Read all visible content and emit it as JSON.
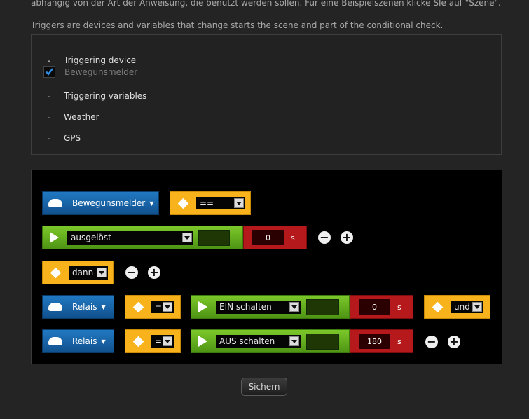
{
  "intro_text": "abhängig von der Art der Anweisung, die benutzt werden sollen. Für eine Beispielszenen klicke SIe auf \"Szene\".",
  "triggers_note": "Triggers are devices and variables that change starts the scene and part of the conditional check.",
  "triggers": {
    "device": {
      "label": "Triggering device",
      "checked_item": "Bewegunsmelder"
    },
    "variables": {
      "label": "Triggering variables"
    },
    "weather": {
      "label": "Weather"
    },
    "gps": {
      "label": "GPS"
    }
  },
  "scene": {
    "row1": {
      "device": "Bewegunsmelder",
      "operator": "=="
    },
    "row2": {
      "action": "ausgelöst",
      "delay": "0",
      "unit": "s"
    },
    "row3": {
      "operator": "dann"
    },
    "row4": {
      "device": "Relais",
      "operator": "=",
      "action": "EIN schalten",
      "delay": "0",
      "unit": "s",
      "logic": "und"
    },
    "row5": {
      "device": "Relais",
      "operator": "=",
      "action": "AUS schalten",
      "delay": "180",
      "unit": "s"
    }
  },
  "buttons": {
    "minus": "−",
    "plus": "+",
    "save": "Sichern"
  },
  "colors": {
    "blue": "#1a65a8",
    "yellow": "#f7b21c",
    "green": "#6cb422",
    "red": "#b5191b",
    "background": "#242424"
  }
}
